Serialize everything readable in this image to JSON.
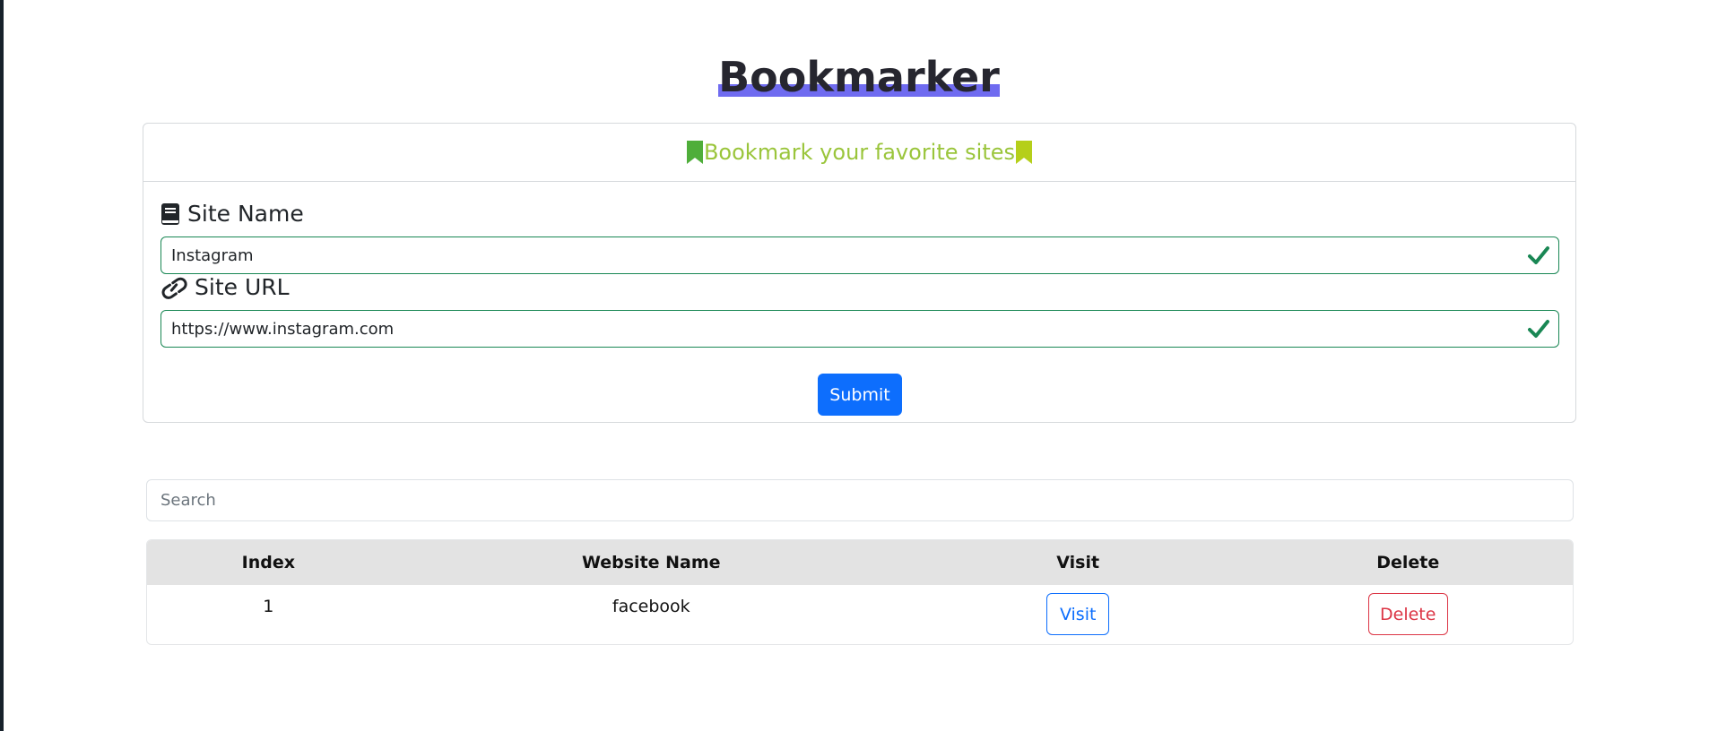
{
  "header": {
    "title": "Bookmarker"
  },
  "form": {
    "card_title": "Bookmark your favorite sites",
    "site_name_label": "Site Name",
    "site_name_value": "Instagram",
    "site_url_label": "Site URL",
    "site_url_value": "https://www.instagram.com",
    "submit_label": "Submit",
    "icons": {
      "header_left": "bookmark-icon",
      "header_right": "bookmark-icon",
      "site_name": "book-icon",
      "site_url": "link-icon",
      "valid": "check-icon"
    },
    "colors": {
      "card_title": "#9ac53b",
      "valid": "#198754",
      "submit": "#0d6efd"
    }
  },
  "search": {
    "placeholder": "Search",
    "value": ""
  },
  "table": {
    "headers": [
      "Index",
      "Website Name",
      "Visit",
      "Delete"
    ],
    "rows": [
      {
        "index": "1",
        "name": "facebook",
        "visit_label": "Visit",
        "delete_label": "Delete"
      }
    ]
  }
}
